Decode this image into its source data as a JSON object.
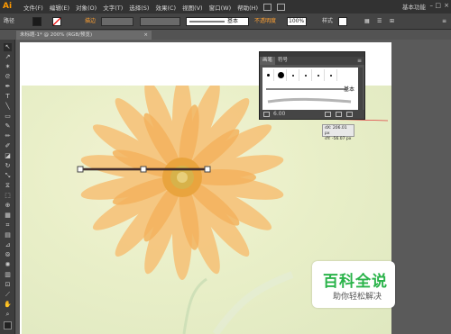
{
  "app": {
    "logo": "Ai"
  },
  "menu": [
    "文件(F)",
    "编辑(E)",
    "对象(O)",
    "文字(T)",
    "选择(S)",
    "效果(C)",
    "视图(V)",
    "窗口(W)",
    "帮助(H)"
  ],
  "workspace": {
    "label": "基本功能",
    "dropdown_icon": "chevron-down-icon"
  },
  "window_controls": {
    "minimize": "–",
    "maximize": "□",
    "close": "×"
  },
  "control_bar": {
    "selection_label": "路径",
    "stroke_label": "描边",
    "brush_label": "基本",
    "opacity_label": "不透明度",
    "opacity_value": "100%",
    "style_label": "样式"
  },
  "document_tab": {
    "title": "未标题-1* @ 200% (RGB/预览)",
    "close": "×"
  },
  "brush_panel": {
    "tabs": [
      "画笔",
      "符号"
    ],
    "active_tab": "画笔",
    "brush_name": "基本",
    "stroke_value": "6.00"
  },
  "drag_tooltip": {
    "dx": "dX: 206.01 px",
    "dy": "dY: -56.07 px"
  },
  "watermark": {
    "title": "百科全说",
    "subtitle": "助你轻松解决"
  },
  "colors": {
    "accent": "#ff9a00",
    "panel_bg": "#535353",
    "menubar_bg": "#323232",
    "watermark_green": "#2ab34a"
  }
}
